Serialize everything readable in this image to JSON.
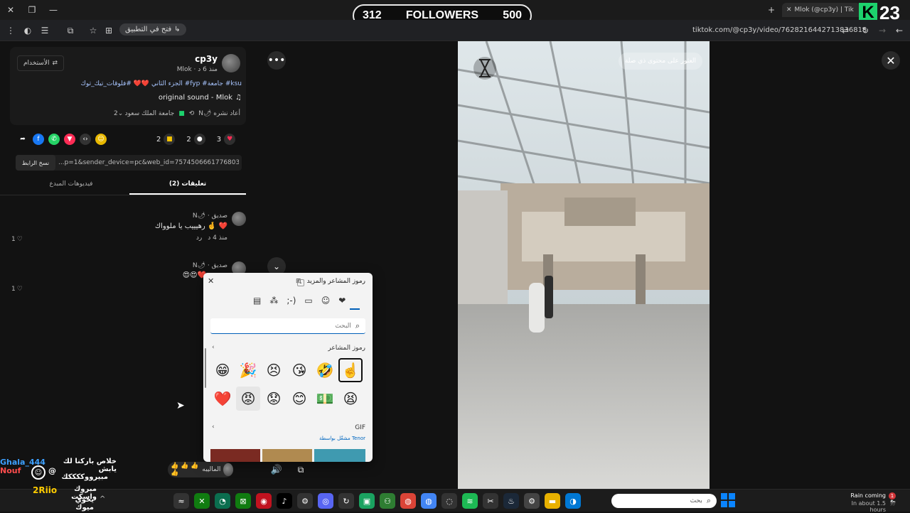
{
  "browser": {
    "tab_title": "Mlok (@cp3y) | Tik",
    "open_in_app": "فتح في التطبيق",
    "url": "tiktok.com/@cp3y/video/7628216442713836818"
  },
  "overlay": {
    "followers_current": "312",
    "followers_label": "FOLLOWERS",
    "followers_goal": "500",
    "k_logo": "K",
    "k_number": "23"
  },
  "post": {
    "username": "cp3y",
    "meta": "Mlok · منذ 6 د",
    "import_button": "الأستخدام",
    "caption": "الجزء الثاني ❤️❤️ #فلوقات_تيك_توك #fyp #جامعة #ksu",
    "sound": "original sound - Mlok",
    "repost_info": "N🌶 أعاد نشره",
    "university_tag": "جامعة الملك سعود",
    "likes": "3",
    "comments": "2",
    "saves": "2",
    "link_value": "...p=1&sender_device=pc&web_id=7574506661776803336",
    "copy_link": "نسخ الرابط"
  },
  "tabs": {
    "comments": "تعليقات (2)",
    "creator_videos": "فيديوهات المبدع"
  },
  "comments": [
    {
      "author": "N🌶 · صديق",
      "text": "رهيييب يا ملوواك 🤞 ❤️",
      "time": "منذ 4 د",
      "reply": "رد",
      "likes": "1"
    },
    {
      "author": "N🌶 · صديق",
      "text": "😍😍❤️",
      "likes": "1"
    }
  ],
  "video": {
    "overlay_text": "العثور على محتوى ذي صلة"
  },
  "emoji_panel": {
    "title": "رموز المشاعر والمزيد",
    "search_placeholder": "البحث",
    "section_emoji": "رموز المشاعر",
    "section_gif": "GIF",
    "tenor": "مشغّل بواسطة Tenor",
    "row1": [
      "☝️",
      "🤣",
      "😘",
      "😣",
      "🎉",
      "😁"
    ],
    "row2": [
      "😫",
      "💵",
      "😊",
      "😟",
      "😡",
      "❤️"
    ]
  },
  "chat_overlay": {
    "line1": "خلاص باركنا لك يابش",
    "user1": "Ghala_444",
    "line2": "مبيرووككككك",
    "user2": "Nouf",
    "line3": "مبروك واسكت",
    "user3": "2Riio",
    "line4": "يخوي ميوك",
    "mention_text": "الماليبه",
    "emojis": "👍 👍 👍 👍"
  },
  "taskbar": {
    "search_placeholder": "بحث",
    "weather_title": "Rain coming",
    "weather_sub": "In about 1.5 hours",
    "notification_count": "1"
  }
}
